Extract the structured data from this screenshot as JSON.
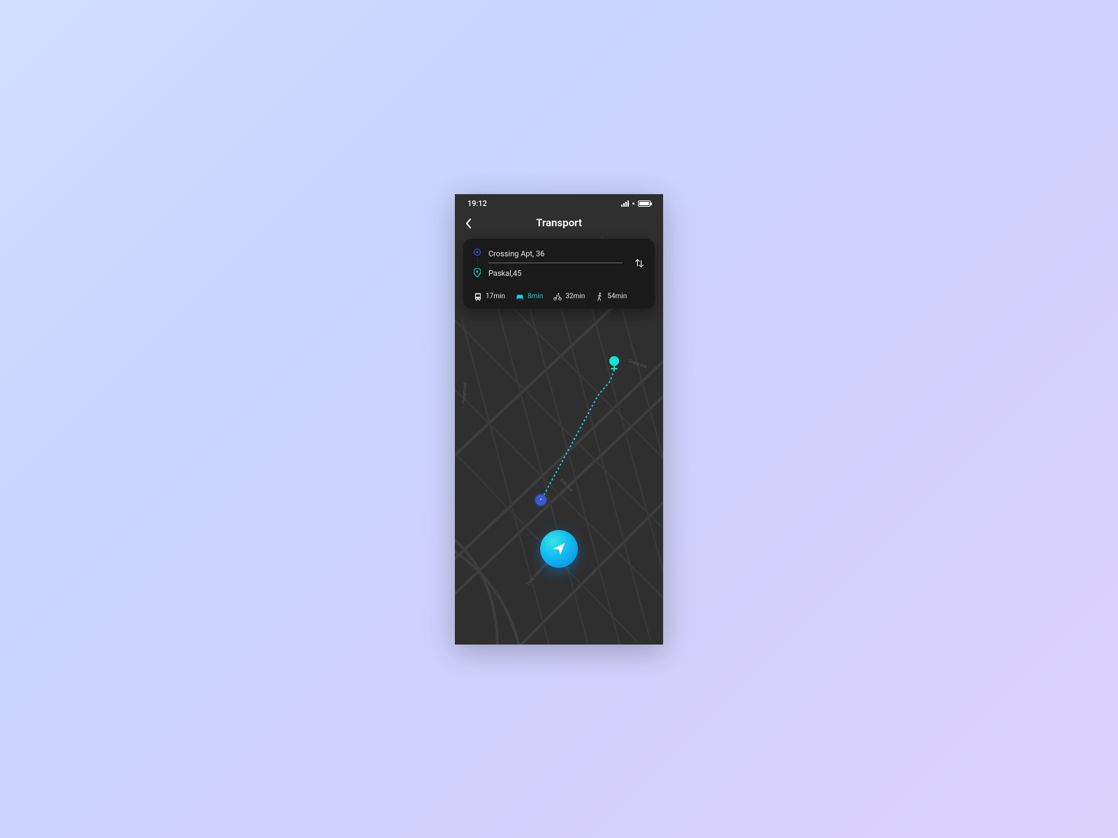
{
  "status": {
    "time": "19:12"
  },
  "header": {
    "title": "Transport"
  },
  "route": {
    "origin": "Crossing Apt,  36",
    "destination": "Paskal,45"
  },
  "modes": [
    {
      "id": "transit",
      "duration": "17min",
      "active": false
    },
    {
      "id": "car",
      "duration": "8min",
      "active": true
    },
    {
      "id": "bike",
      "duration": "32min",
      "active": false
    },
    {
      "id": "walk",
      "duration": "54min",
      "active": false
    }
  ],
  "colors": {
    "accent": "#12d3e8",
    "primary_blue": "#2b6af7"
  }
}
